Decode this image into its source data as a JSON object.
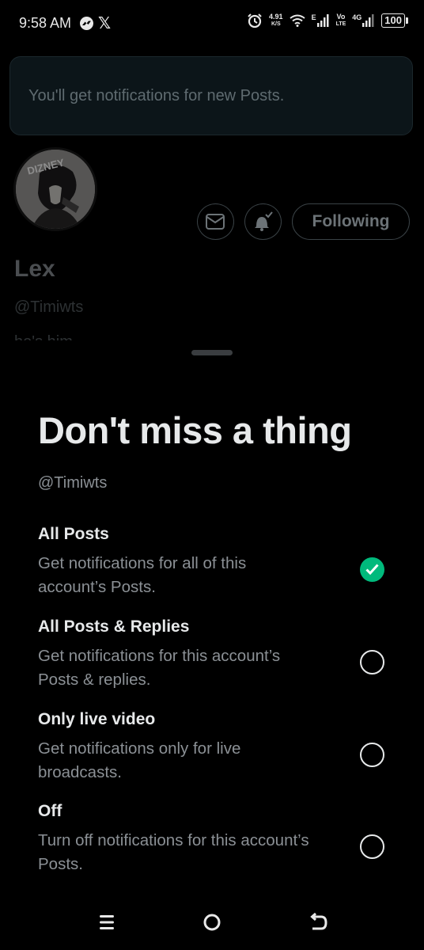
{
  "status_bar": {
    "time": "9:58 AM",
    "x_logo": "𝕏",
    "net_speed_value": "4.91",
    "net_speed_unit": "K/S",
    "network_label": "E",
    "volte_label_1": "Vo",
    "volte_label_2": "LTE",
    "network_4g": "4G",
    "battery": "100",
    "icons": [
      "messenger-icon",
      "x-logo-icon",
      "alarm-icon",
      "wifi-icon",
      "signal-icon",
      "battery-icon"
    ]
  },
  "background_profile": {
    "toast_text": "You'll get notifications for new Posts.",
    "avatar_text": "DIZNEY",
    "following_label": "Following",
    "name": "Lex",
    "handle": "@Timiwts",
    "bio": "he's him"
  },
  "sheet": {
    "title": "Don't miss a thing",
    "handle": "@Timiwts",
    "options": [
      {
        "title": "All Posts",
        "line1": "Get notifications for all of this",
        "line2": "account’s Posts.",
        "selected": true
      },
      {
        "title": "All Posts & Replies",
        "line1": "Get notifications for this account’s",
        "line2": "Posts & replies.",
        "selected": false
      },
      {
        "title": "Only live video",
        "line1": "Get notifications only for live",
        "line2": "broadcasts.",
        "selected": false
      },
      {
        "title": "Off",
        "line1": "Turn off notifications for this account’s",
        "line2": "Posts.",
        "selected": false
      }
    ]
  },
  "nav": [
    "menu-icon",
    "home-circle-icon",
    "back-icon"
  ],
  "colors": {
    "background": "#000000",
    "text_primary": "#e7e9ea",
    "text_secondary": "#8b9095",
    "selected_green": "#00ba7c",
    "toast_bg": "#0c1519"
  }
}
